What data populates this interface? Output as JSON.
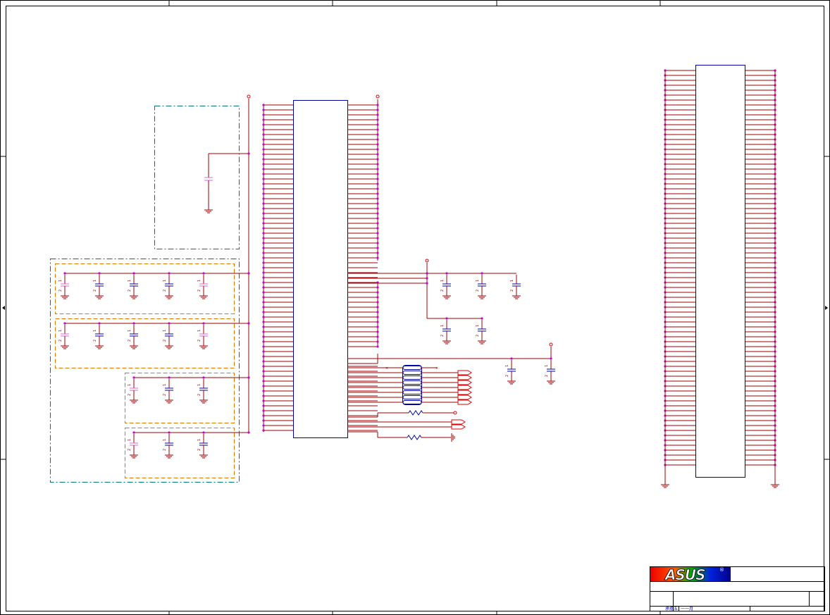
{
  "title_block": {
    "logo_text": "ASUS",
    "logo_registered": "®",
    "label_left": "承擔五",
    "label_right": "一一月"
  },
  "colors": {
    "wire": "#a00000",
    "junction": "#cc00cc",
    "component": "#0000aa",
    "dash_outer": "#007777",
    "dash_inner": "#dd7700",
    "net_flag": "#dd0000",
    "frame": "#000000"
  },
  "icons": [
    "capacitor-symbol",
    "ground-symbol",
    "resistor-symbol",
    "power-rail-symbol",
    "net-flag-symbol",
    "junction-dot"
  ]
}
